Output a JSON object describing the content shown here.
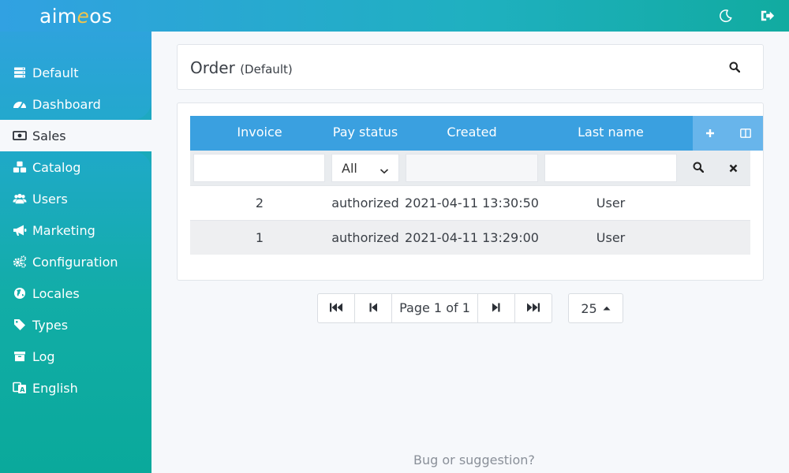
{
  "app": {
    "logo": {
      "pre": "aim",
      "accent": "e",
      "post": "os"
    }
  },
  "colors": {
    "brand_blue": "#31a1e2",
    "brand_teal": "#11aba0",
    "table_header": "#3aa0e0",
    "logo_accent": "#f3c54a"
  },
  "topbar": {
    "icons": [
      "moon-icon",
      "sign-out-icon"
    ]
  },
  "sidebar": {
    "items": [
      {
        "label": "Default",
        "icon": "server-icon"
      },
      {
        "label": "Dashboard",
        "icon": "tachometer-icon"
      },
      {
        "label": "Sales",
        "icon": "money-bill-icon",
        "active": true
      },
      {
        "label": "Catalog",
        "icon": "cubes-icon"
      },
      {
        "label": "Users",
        "icon": "users-icon"
      },
      {
        "label": "Marketing",
        "icon": "bullhorn-icon"
      },
      {
        "label": "Configuration",
        "icon": "cogs-icon"
      },
      {
        "label": "Locales",
        "icon": "globe-icon"
      },
      {
        "label": "Types",
        "icon": "tag-icon"
      },
      {
        "label": "Log",
        "icon": "archive-icon"
      },
      {
        "label": "English",
        "icon": "language-icon"
      }
    ]
  },
  "header": {
    "title": "Order",
    "subtitle": "(Default)"
  },
  "table": {
    "columns": [
      "Invoice",
      "Pay status",
      "Created",
      "Last name"
    ],
    "filter": {
      "pay_status_selected": "All"
    },
    "rows": [
      {
        "invoice": "2",
        "pay_status": "authorized",
        "created": "2021-04-11 13:30:50",
        "last_name": "User"
      },
      {
        "invoice": "1",
        "pay_status": "authorized",
        "created": "2021-04-11 13:29:00",
        "last_name": "User"
      }
    ]
  },
  "pager": {
    "page_text": "Page 1 of 1",
    "per_page": "25"
  },
  "footer": {
    "link": "Bug or suggestion?"
  }
}
